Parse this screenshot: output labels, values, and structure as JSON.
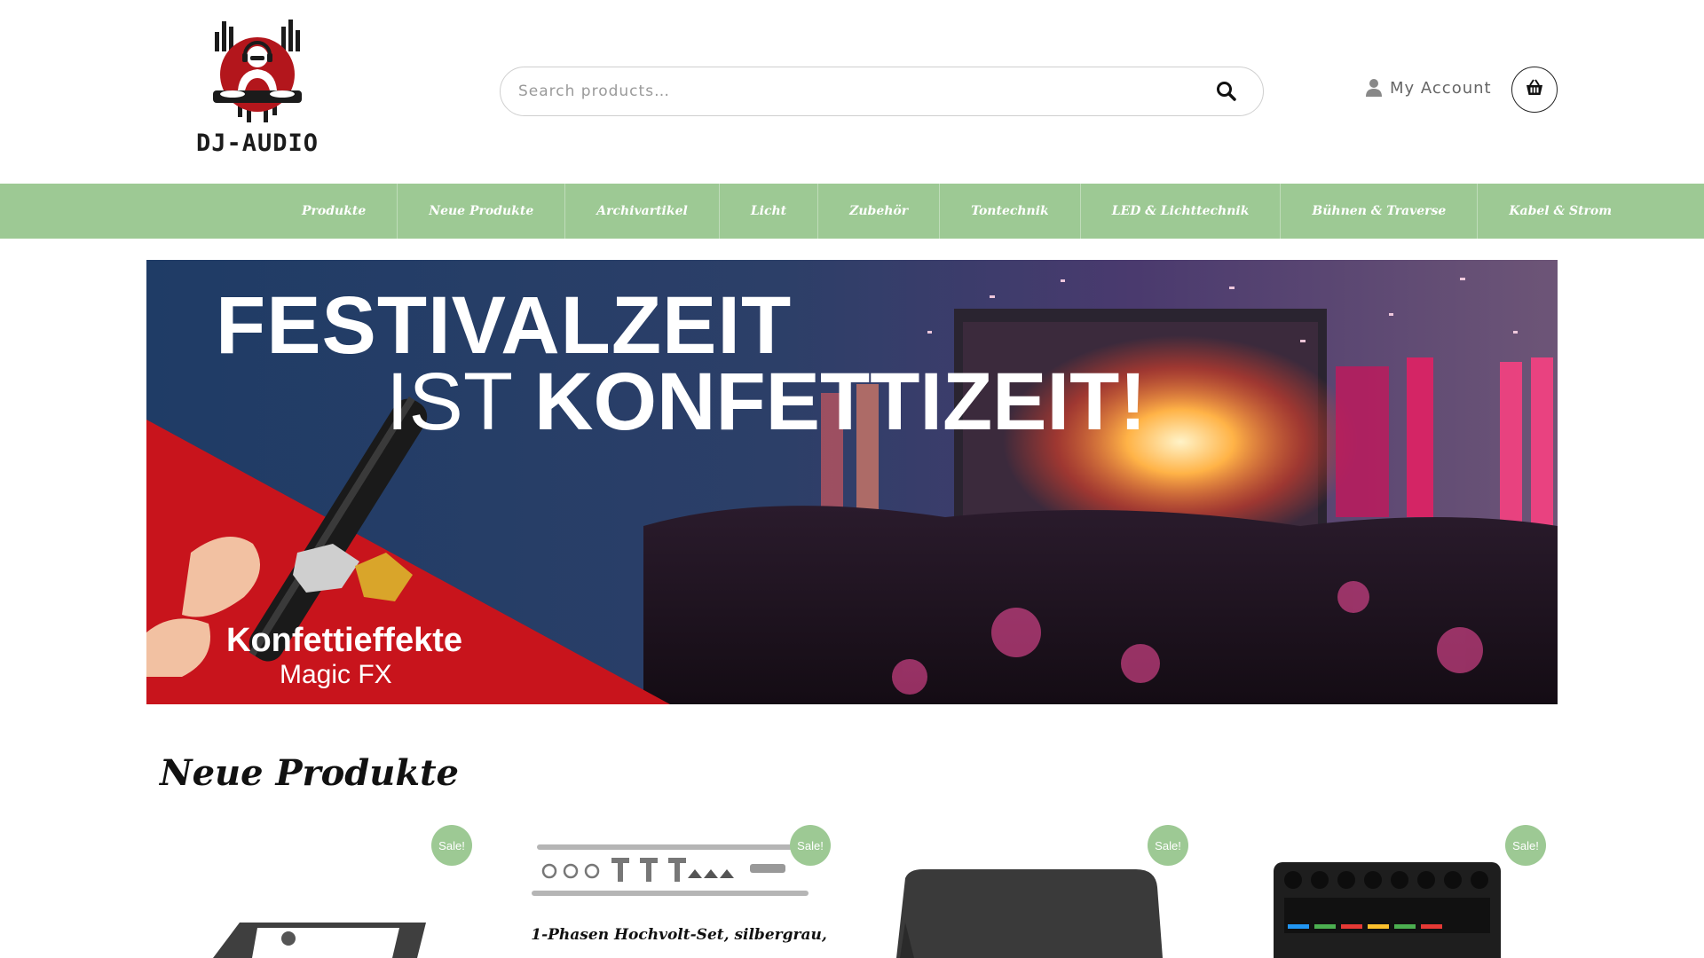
{
  "brand": {
    "name": "DJ-AUDIO",
    "accent": "#9dc994"
  },
  "search": {
    "placeholder": "Search products…",
    "icon": "search-icon"
  },
  "header": {
    "account_label": "My Account",
    "account_icon": "user-icon",
    "cart_icon": "basket-icon"
  },
  "nav": {
    "items": [
      {
        "label": "Produkte"
      },
      {
        "label": "Neue Produkte"
      },
      {
        "label": "Archivartikel"
      },
      {
        "label": "Licht"
      },
      {
        "label": "Zubehör"
      },
      {
        "label": "Tontechnik"
      },
      {
        "label": "LED & Lichttechnik"
      },
      {
        "label": "Bühnen & Traverse"
      },
      {
        "label": "Kabel & Strom"
      }
    ]
  },
  "banner": {
    "title_line1": "FESTIVALZEIT",
    "title_line2_thin": "IST",
    "title_line2_bold": "KONFETTIZEIT!",
    "subtitle": "Konfettieffekte",
    "brand_line": "Magic FX"
  },
  "section": {
    "title": "Neue Produkte"
  },
  "products": [
    {
      "sale": "Sale!",
      "name": ""
    },
    {
      "sale": "Sale!",
      "name": "1-Phasen Hochvolt-Set, silbergrau,"
    },
    {
      "sale": "Sale!",
      "name": ""
    },
    {
      "sale": "Sale!",
      "name": ""
    }
  ]
}
